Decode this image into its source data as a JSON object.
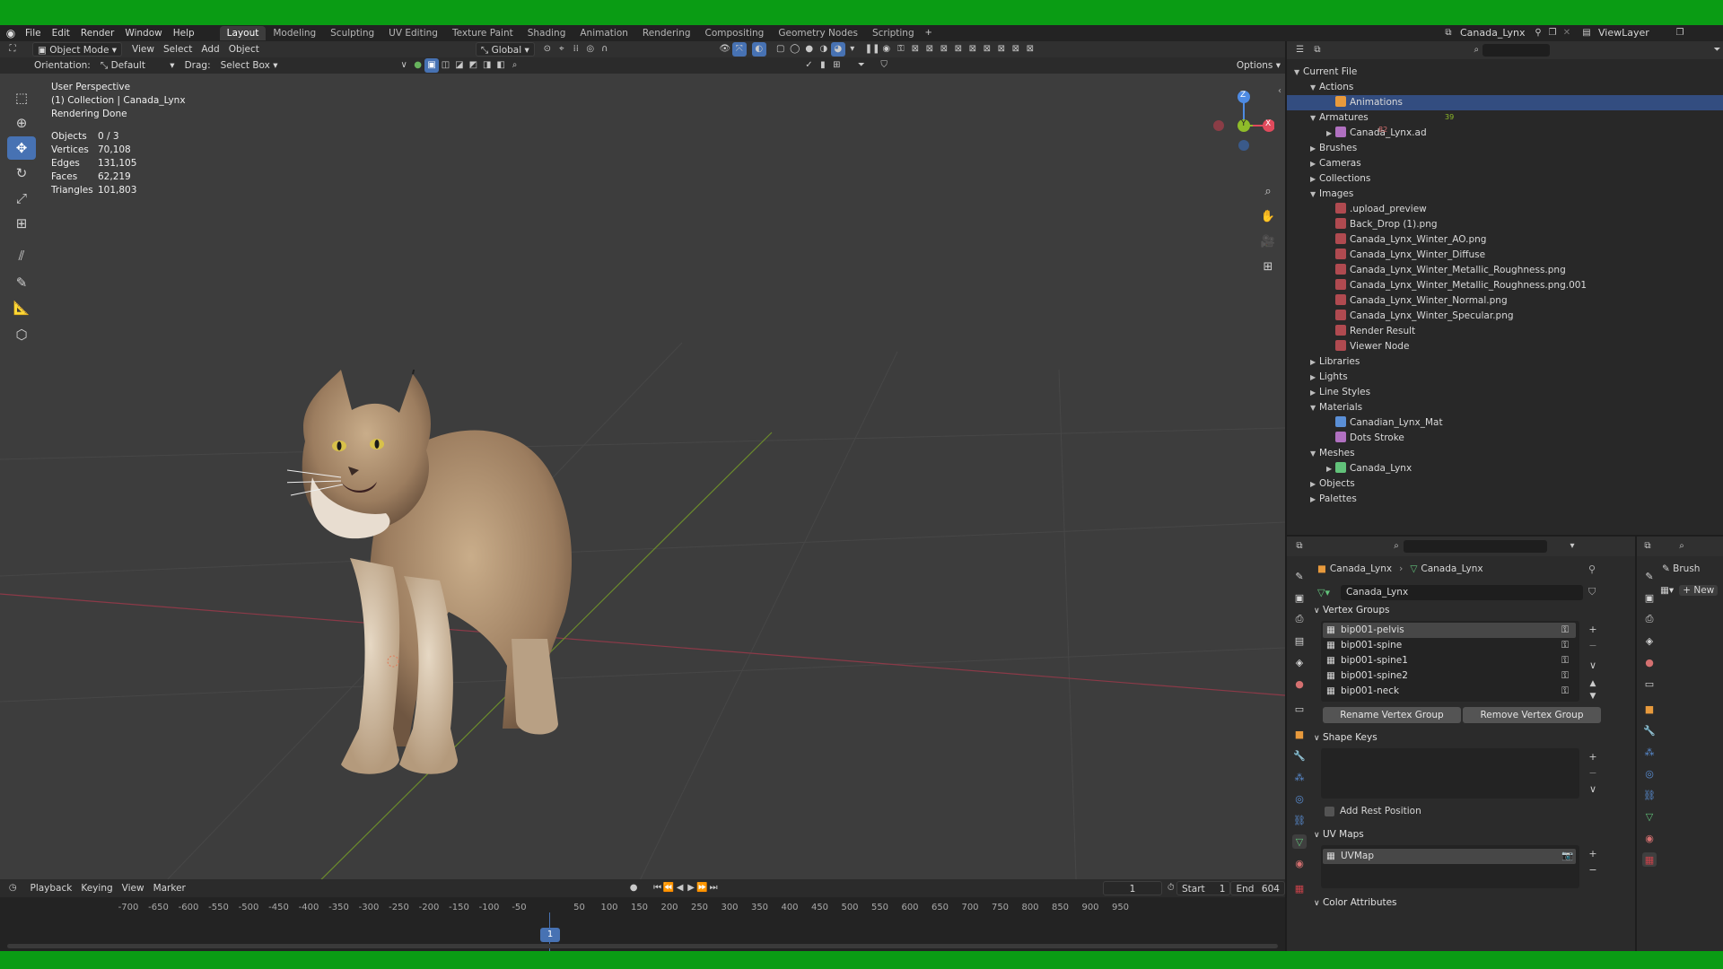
{
  "menus": [
    "File",
    "Edit",
    "Render",
    "Window",
    "Help"
  ],
  "workspaces": [
    "Layout",
    "Modeling",
    "Sculpting",
    "UV Editing",
    "Texture Paint",
    "Shading",
    "Animation",
    "Rendering",
    "Compositing",
    "Geometry Nodes",
    "Scripting"
  ],
  "top_right": {
    "scene": "Canada_Lynx",
    "view_layer": "ViewLayer"
  },
  "viewport_header": {
    "mode": "Object Mode",
    "menus": [
      "View",
      "Select",
      "Add",
      "Object"
    ],
    "transform_orientation": "Global",
    "orientation_label": "Orientation:",
    "orientation_value": "Default",
    "drag_label": "Drag:",
    "drag_value": "Select Box",
    "options": "Options"
  },
  "overlay": {
    "line1": "User Perspective",
    "line2": "(1) Collection | Canada_Lynx",
    "line3": "Rendering Done",
    "stats": [
      {
        "k": "Objects",
        "v": "0 / 3"
      },
      {
        "k": "Vertices",
        "v": "70,108"
      },
      {
        "k": "Edges",
        "v": "131,105"
      },
      {
        "k": "Faces",
        "v": "62,219"
      },
      {
        "k": "Triangles",
        "v": "101,803"
      }
    ]
  },
  "gizmo": {
    "z": "Z",
    "y": "Y",
    "x": "X"
  },
  "timeline": {
    "menus": [
      "Playback",
      "Keying",
      "View",
      "Marker"
    ],
    "current_frame": "1",
    "start_label": "Start",
    "start": "1",
    "end_label": "End",
    "end": "604",
    "ticks": [
      "-700",
      "-650",
      "-600",
      "-550",
      "-500",
      "-450",
      "-400",
      "-350",
      "-300",
      "-250",
      "-200",
      "-150",
      "-100",
      "-50",
      "1",
      "50",
      "100",
      "150",
      "200",
      "250",
      "300",
      "350",
      "400",
      "450",
      "500",
      "550",
      "600",
      "650",
      "700",
      "750",
      "800",
      "850",
      "900",
      "950"
    ]
  },
  "outliner": {
    "rows": [
      {
        "label": "Current File",
        "depth": 0,
        "open": true
      },
      {
        "label": "Actions",
        "depth": 1,
        "open": true
      },
      {
        "label": "Animations",
        "depth": 2,
        "selected": true
      },
      {
        "label": "Armatures",
        "depth": 1,
        "open": true
      },
      {
        "label": "Canada_Lynx.ad",
        "depth": 2,
        "closed": true
      },
      {
        "label": "Brushes",
        "depth": 1,
        "closed": true
      },
      {
        "label": "Cameras",
        "depth": 1,
        "closed": true
      },
      {
        "label": "Collections",
        "depth": 1,
        "closed": true
      },
      {
        "label": "Images",
        "depth": 1,
        "open": true
      },
      {
        "label": ".upload_preview",
        "depth": 2
      },
      {
        "label": "Back_Drop (1).png",
        "depth": 2
      },
      {
        "label": "Canada_Lynx_Winter_AO.png",
        "depth": 2
      },
      {
        "label": "Canada_Lynx_Winter_Diffuse",
        "depth": 2
      },
      {
        "label": "Canada_Lynx_Winter_Metallic_Roughness.png",
        "depth": 2
      },
      {
        "label": "Canada_Lynx_Winter_Metallic_Roughness.png.001",
        "depth": 2
      },
      {
        "label": "Canada_Lynx_Winter_Normal.png",
        "depth": 2
      },
      {
        "label": "Canada_Lynx_Winter_Specular.png",
        "depth": 2
      },
      {
        "label": "Render Result",
        "depth": 2
      },
      {
        "label": "Viewer Node",
        "depth": 2
      },
      {
        "label": "Libraries",
        "depth": 1,
        "closed": true
      },
      {
        "label": "Lights",
        "depth": 1,
        "closed": true
      },
      {
        "label": "Line Styles",
        "depth": 1,
        "closed": true
      },
      {
        "label": "Materials",
        "depth": 1,
        "open": true
      },
      {
        "label": "Canadian_Lynx_Mat",
        "depth": 2
      },
      {
        "label": "Dots Stroke",
        "depth": 2
      },
      {
        "label": "Meshes",
        "depth": 1,
        "open": true
      },
      {
        "label": "Canada_Lynx",
        "depth": 2,
        "closed": true
      },
      {
        "label": "Objects",
        "depth": 1,
        "closed": true
      },
      {
        "label": "Palettes",
        "depth": 1,
        "closed": true
      }
    ],
    "armature_badge": "39",
    "brush_badge": "82"
  },
  "properties": {
    "breadcrumb_object": "Canada_Lynx",
    "breadcrumb_mesh": "Canada_Lynx",
    "mesh_name": "Canada_Lynx",
    "vertex_groups_title": "Vertex Groups",
    "vertex_groups": [
      "bip001-pelvis",
      "bip001-spine",
      "bip001-spine1",
      "bip001-spine2",
      "bip001-neck"
    ],
    "rename_btn": "Rename Vertex Group",
    "remove_btn": "Remove Vertex Group",
    "shape_keys_title": "Shape Keys",
    "add_rest_position": "Add Rest Position",
    "uv_maps_title": "UV Maps",
    "uv_map": "UVMap",
    "color_attributes_title": "Color Attributes"
  },
  "tool_panel": {
    "brush_label": "Brush",
    "new_label": "New"
  },
  "colors": {
    "accent": "#4772b3",
    "selection": "#334d80",
    "chroma_green": "#0a9c14"
  }
}
